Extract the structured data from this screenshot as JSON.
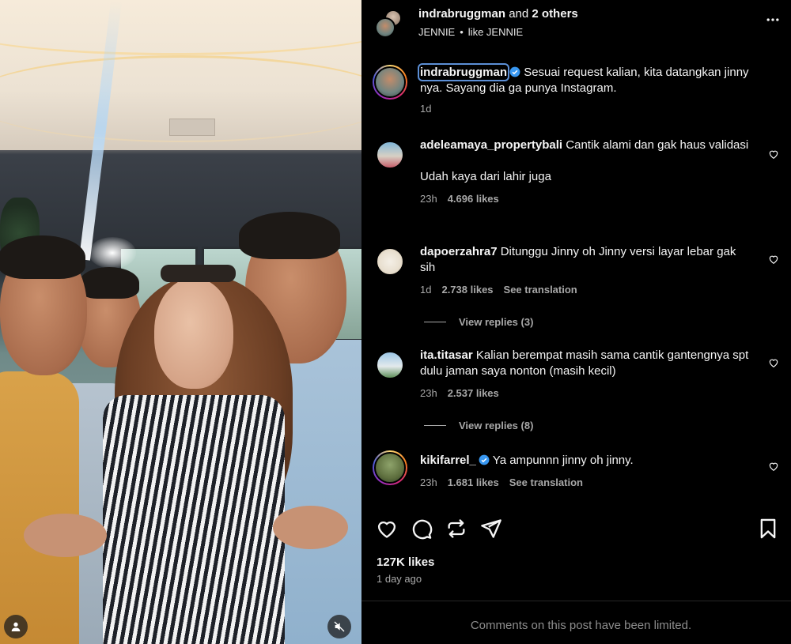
{
  "post": {
    "author": "indrabruggman",
    "and_text": "and",
    "others": "2 others",
    "audio_left": "JENNIE",
    "audio_sep": "•",
    "audio_right": "like JENNIE"
  },
  "comments": [
    {
      "username": "indrabruggman",
      "verified": true,
      "text": "Sesuai request kalian, kita datangkan jinny nya. Sayang dia ga punya Instagram.",
      "time": "1d"
    },
    {
      "username": "adeleamaya_propertybali",
      "verified": false,
      "text": "Cantik alami dan gak haus validasi",
      "text2": "Udah kaya dari lahir juga",
      "time": "23h",
      "likes": "4.696 likes"
    },
    {
      "username": "dapoerzahra7",
      "verified": false,
      "text": "Ditunggu Jinny oh Jinny versi layar lebar gak sih",
      "time": "1d",
      "likes": "2.738 likes",
      "translate": "See translation",
      "replies": "View replies (3)"
    },
    {
      "username": "ita.titasar",
      "verified": false,
      "text": "Kalian berempat masih sama cantik gantengnya spt dulu jaman saya nonton (masih kecil)",
      "time": "23h",
      "likes": "2.537 likes",
      "replies": "View replies (8)"
    },
    {
      "username": "kikifarrel_",
      "verified": true,
      "text": "Ya ampunnn jinny oh jinny.",
      "time": "23h",
      "likes": "1.681 likes",
      "translate": "See translation"
    }
  ],
  "footer": {
    "likes": "127K likes",
    "posted": "1 day ago",
    "limited_notice": "Comments on this post have been limited."
  },
  "icons": {
    "more": "more-options-icon",
    "like": "heart-icon",
    "comment": "comment-icon",
    "repost": "repost-icon",
    "share": "send-icon",
    "save": "bookmark-icon",
    "tag": "user-tag-icon",
    "mute": "muted-speaker-icon"
  },
  "colors": {
    "background": "#000000",
    "text": "#f5f5f5",
    "secondary": "#a8a8a8",
    "verified": "#3897f0"
  }
}
